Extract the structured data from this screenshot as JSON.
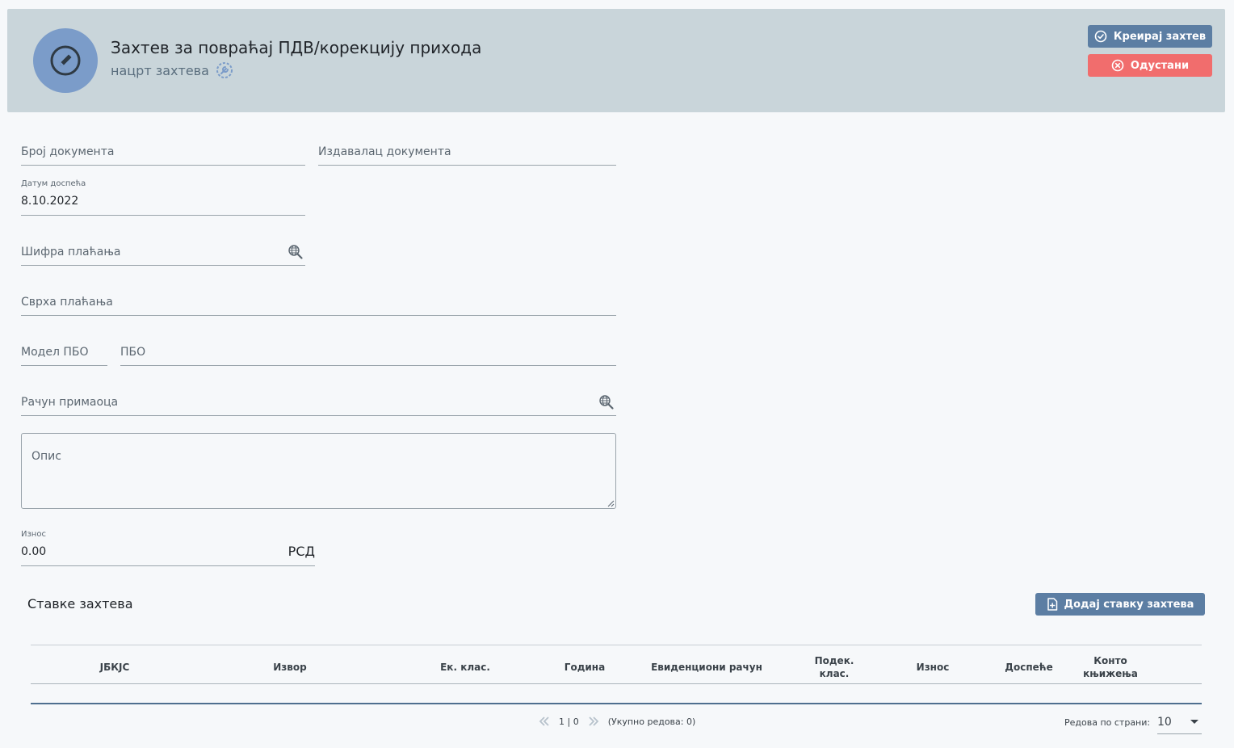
{
  "header": {
    "title": "Захтев за повраћај ПДВ/корекцију прихода",
    "subtitle": "нацрт захтева",
    "create_button": "Креирај захтев",
    "cancel_button": "Одустани"
  },
  "form": {
    "document_number": {
      "placeholder": "Број документа"
    },
    "document_issuer": {
      "placeholder": "Издавалац документа"
    },
    "due_date": {
      "label": "Датум доспећа",
      "value": "8.10.2022"
    },
    "payment_code": {
      "placeholder": "Шифра плаћања"
    },
    "payment_purpose": {
      "placeholder": "Сврха плаћања"
    },
    "pbo_model": {
      "placeholder": "Модел ПБО"
    },
    "pbo": {
      "placeholder": "ПБО"
    },
    "recipient_account": {
      "placeholder": "Рачун примаоца"
    },
    "description": {
      "placeholder": "Опис"
    },
    "amount": {
      "label": "Износ",
      "value": "0.00",
      "currency": "РСД"
    }
  },
  "items": {
    "title": "Ставке захтева",
    "add_button": "Додај ставку захтева",
    "columns": [
      "ЈБКЈС",
      "Извор",
      "Ек. клас.",
      "Година",
      "Евиденциони рачун",
      "Подек. клас.",
      "Износ",
      "Доспеће",
      "Конто књижења"
    ],
    "rows": [],
    "pagination": {
      "page_info": "1 | 0",
      "total": "(Укупно редова: 0)",
      "rows_per_page_label": "Редова по страни:",
      "rows_per_page": "10"
    }
  },
  "colors": {
    "header_bg": "#c9d5da",
    "avatar": "#7b9cc9",
    "primary_button": "#5c7ea3",
    "cancel_button": "#f16d6d"
  }
}
